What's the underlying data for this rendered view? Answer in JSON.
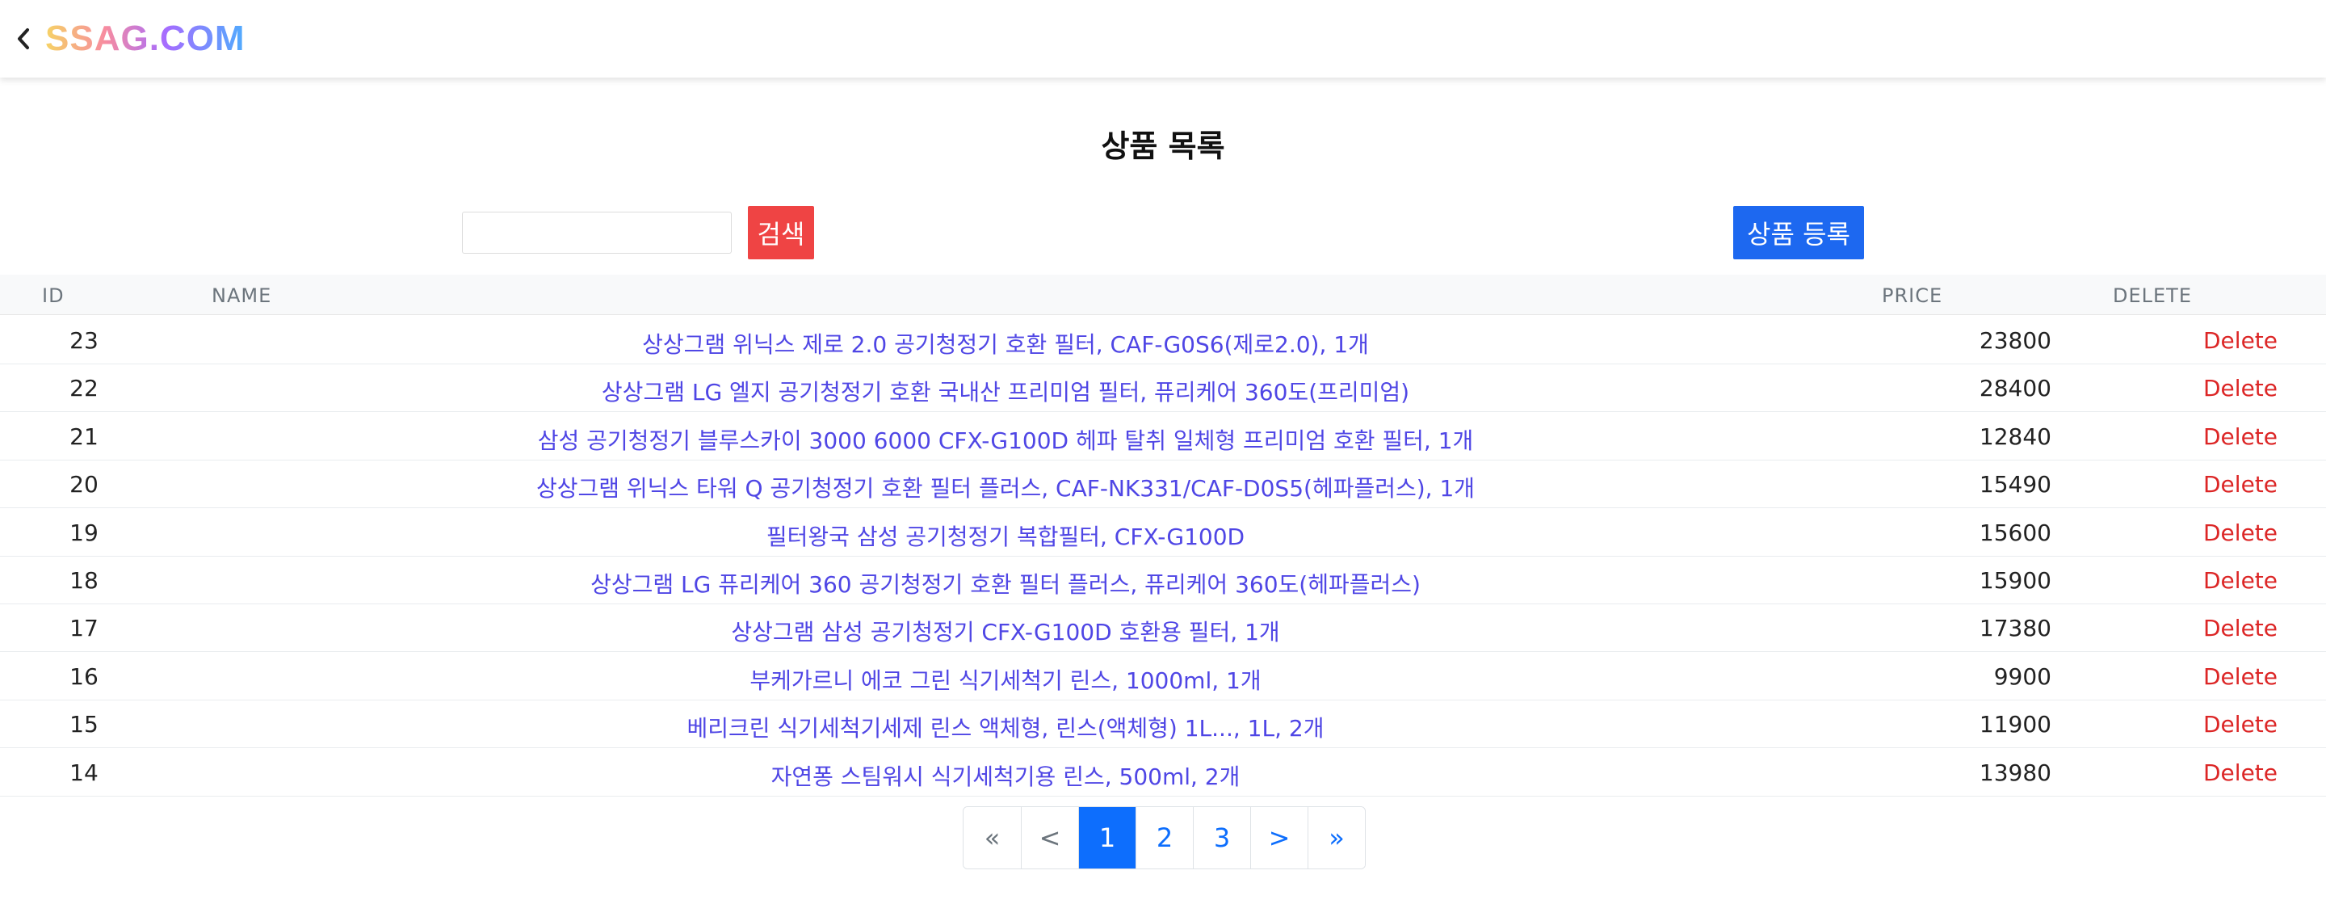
{
  "header": {
    "logo": "SSAG.COM",
    "back_icon": "chevron-left-icon"
  },
  "page_title": "상품 목록",
  "search": {
    "value": "",
    "placeholder": "",
    "button_label": "검색"
  },
  "register_label": "상품 등록",
  "table": {
    "columns": [
      "ID",
      "NAME",
      "PRICE",
      "DELETE"
    ],
    "rows": [
      {
        "id": "23",
        "name": "상상그램 위닉스 제로 2.0 공기청정기 호환 필터, CAF-G0S6(제로2.0), 1개",
        "price": "23800",
        "delete": "Delete"
      },
      {
        "id": "22",
        "name": "상상그램 LG 엘지 공기청정기 호환 국내산 프리미엄 필터, 퓨리케어 360도(프리미엄)",
        "price": "28400",
        "delete": "Delete"
      },
      {
        "id": "21",
        "name": "삼성 공기청정기 블루스카이 3000 6000 CFX-G100D 헤파 탈취 일체형 프리미엄 호환 필터, 1개",
        "price": "12840",
        "delete": "Delete"
      },
      {
        "id": "20",
        "name": "상상그램 위닉스 타워 Q 공기청정기 호환 필터 플러스, CAF-NK331/CAF-D0S5(헤파플러스), 1개",
        "price": "15490",
        "delete": "Delete"
      },
      {
        "id": "19",
        "name": "필터왕국 삼성 공기청정기 복합필터, CFX-G100D",
        "price": "15600",
        "delete": "Delete"
      },
      {
        "id": "18",
        "name": "상상그램 LG 퓨리케어 360 공기청정기 호환 필터 플러스, 퓨리케어 360도(헤파플러스)",
        "price": "15900",
        "delete": "Delete"
      },
      {
        "id": "17",
        "name": "상상그램 삼성 공기청정기 CFX-G100D 호환용 필터, 1개",
        "price": "17380",
        "delete": "Delete"
      },
      {
        "id": "16",
        "name": "부케가르니 에코 그린 식기세척기 린스, 1000ml, 1개",
        "price": "9900",
        "delete": "Delete"
      },
      {
        "id": "15",
        "name": "베리크린 식기세척기세제 린스 액체형, 린스(액체형) 1L..., 1L, 2개",
        "price": "11900",
        "delete": "Delete"
      },
      {
        "id": "14",
        "name": "자연퐁 스팀워시 식기세척기용 린스, 500ml, 2개",
        "price": "13980",
        "delete": "Delete"
      }
    ]
  },
  "pagination": {
    "first": "«",
    "prev": "<",
    "pages": [
      "1",
      "2",
      "3"
    ],
    "current": "1",
    "next": ">",
    "last": "»"
  },
  "colors": {
    "search_button": "#ef4444",
    "register_button": "#1d68f0",
    "name_link": "#4f46e5",
    "delete_link": "#dc2626",
    "page_active": "#0d6efd"
  }
}
